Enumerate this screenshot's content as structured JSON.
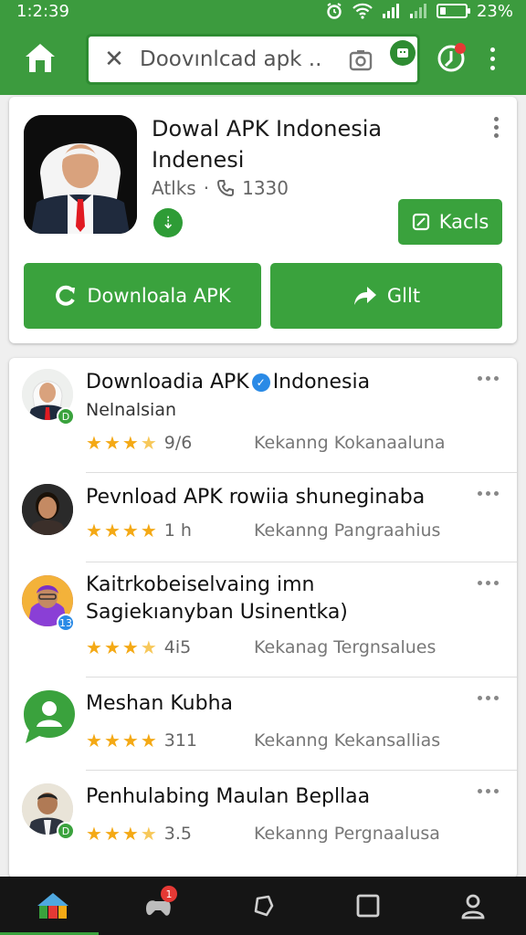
{
  "status_bar": {
    "time": "1:2:39",
    "battery": "23%",
    "battery_level": 0.23
  },
  "app_bar": {
    "search_value": "Doovınlcad apk ...",
    "search_placeholder": "",
    "icons": [
      "home-icon",
      "clear-icon",
      "camera-icon",
      "badge-icon",
      "update-icon",
      "more-icon"
    ]
  },
  "app_card": {
    "title": "Dowal APK Indonesia Indenesi",
    "meta_left": "Atlks",
    "meta_count": "1330",
    "kacls_label": "Kacls",
    "download_label": "Downloala APK",
    "share_label": "Gllt"
  },
  "list": [
    {
      "title_a": "Downloadia APK",
      "title_b": "Indonesia",
      "subtitle": "Nelnalsian",
      "stars": 3.5,
      "rating": "9/6",
      "right": "Kekanng Kokanaaluna",
      "badge": "D",
      "badge_color": "#3aa23d"
    },
    {
      "title": "Pevnload APK rowiia shuneginaba",
      "stars": 4,
      "rating": "1 h",
      "right": "Kekanng Pangraahius"
    },
    {
      "title": "Kaitrkobeiselvaing imn Sagiekıanyban Usinentka)",
      "stars": 3.5,
      "rating": "4i5",
      "right": "Kekanag Tergnsalues",
      "badge": "13",
      "badge_color": "#2a8ae6"
    },
    {
      "title": "Meshan Kubha",
      "stars": 4,
      "rating": "311",
      "right": "Kekanng Kekansallias"
    },
    {
      "title": "Penhulabing Maulan Bepllaa",
      "stars": 3.5,
      "rating": "3.5",
      "right": "Kekanng Pergnaalusa",
      "badge": "D",
      "badge_color": "#3aa23d"
    }
  ],
  "bottom_nav": {
    "items": [
      "home-icon",
      "games-icon",
      "refresh-icon",
      "square-icon",
      "profile-icon"
    ],
    "notification_count": "1"
  },
  "colors": {
    "primary": "#3c9b3e",
    "button": "#3aa23d",
    "star": "#f4a915",
    "nav_bg": "#151515"
  }
}
